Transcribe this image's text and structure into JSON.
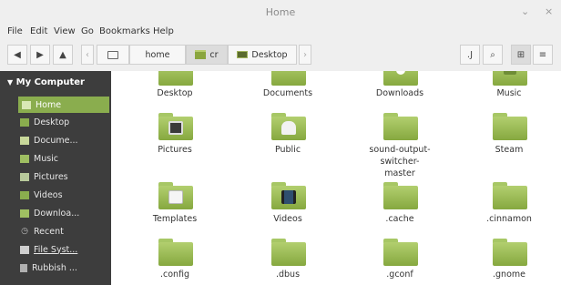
{
  "window": {
    "title": "Home"
  },
  "menubar": [
    "File",
    "Edit",
    "View",
    "Go",
    "Bookmarks",
    "Help"
  ],
  "breadcrumb": [
    "home",
    "cr",
    "Desktop"
  ],
  "sidebar": {
    "header": "My Computer",
    "items": [
      {
        "label": "Home",
        "icon": "home-icon",
        "selected": true
      },
      {
        "label": "Desktop",
        "icon": "desktop-icon"
      },
      {
        "label": "Docume...",
        "icon": "documents-icon"
      },
      {
        "label": "Music",
        "icon": "music-icon"
      },
      {
        "label": "Pictures",
        "icon": "pictures-icon"
      },
      {
        "label": "Videos",
        "icon": "videos-icon"
      },
      {
        "label": "Downloa...",
        "icon": "downloads-icon"
      },
      {
        "label": "Recent",
        "icon": "recent-icon"
      },
      {
        "label": "File Syst...",
        "icon": "filesystem-icon"
      },
      {
        "label": "Rubbish ...",
        "icon": "trash-icon"
      }
    ]
  },
  "files": [
    {
      "label": "Desktop"
    },
    {
      "label": "Documents"
    },
    {
      "label": "Downloads"
    },
    {
      "label": "Music"
    },
    {
      "label": "Pictures",
      "emblem": "camera"
    },
    {
      "label": "Public",
      "emblem": "person"
    },
    {
      "label": "sound-output-switcher-\nmaster"
    },
    {
      "label": "Steam"
    },
    {
      "label": "Templates",
      "emblem": "template"
    },
    {
      "label": "Videos",
      "emblem": "film"
    },
    {
      "label": ".cache"
    },
    {
      "label": ".cinnamon"
    },
    {
      "label": ".config"
    },
    {
      "label": ".dbus"
    },
    {
      "label": ".gconf"
    },
    {
      "label": ".gnome"
    }
  ],
  "colors": {
    "accent": "#8aad4e",
    "sidebar_bg": "#3d3d3d",
    "folder": "#9dbd57"
  }
}
